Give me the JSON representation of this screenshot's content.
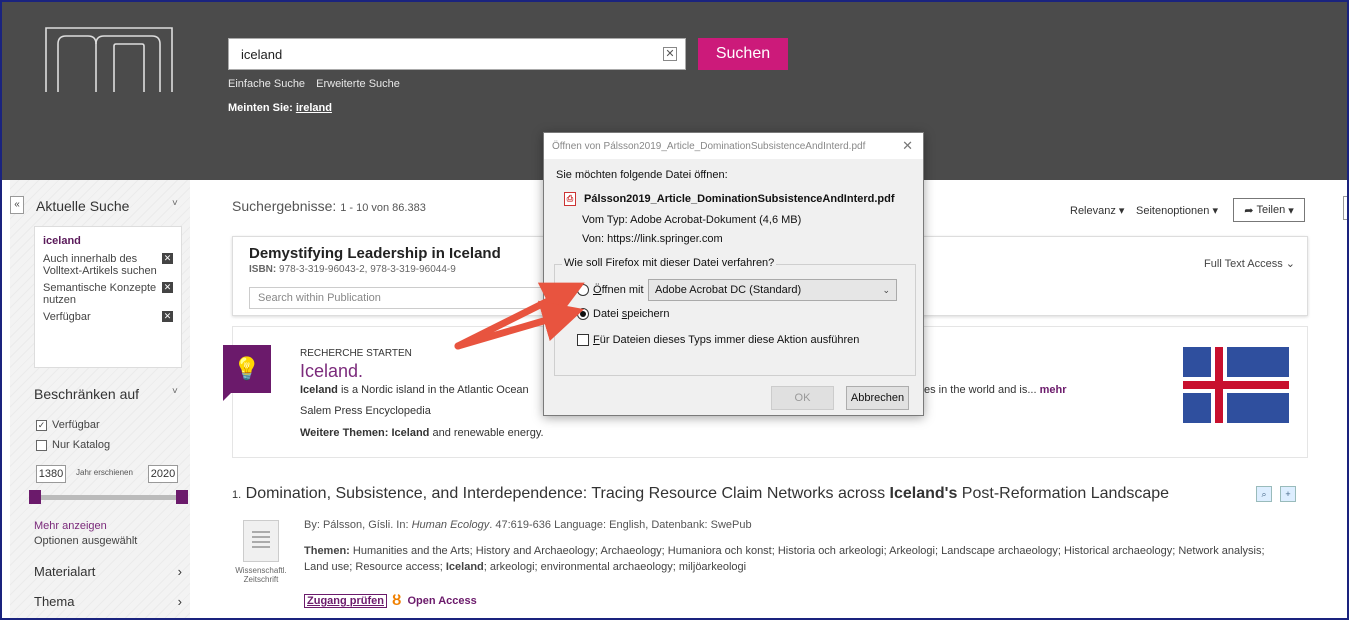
{
  "header": {
    "search_value": "iceland",
    "search_button": "Suchen",
    "links": [
      "Einfache Suche",
      "Erweiterte Suche"
    ],
    "did_you_mean_label": "Meinten Sie:",
    "did_you_mean_term": "ireland"
  },
  "sidebar": {
    "current_search_title": "Aktuelle Suche",
    "current_term": "iceland",
    "current_items": [
      "Auch innerhalb des Volltext-Artikels suchen",
      "Semantische Konzepte nutzen",
      "Verfügbar"
    ],
    "limit_title": "Beschränken auf",
    "limit_items": [
      "Verfügbar",
      "Nur Katalog"
    ],
    "year_from": "1380",
    "year_label": "Jahr erschienen",
    "year_to": "2020",
    "more_link": "Mehr anzeigen",
    "options_selected": "Optionen ausgewählt",
    "facets": [
      "Materialart",
      "Thema"
    ]
  },
  "results": {
    "count_label": "Suchergebnisse:",
    "count_value": "1 - 10 von 86.383",
    "relevance": "Relevanz",
    "page_options": "Seitenoptionen",
    "share": "Teilen"
  },
  "publication": {
    "title": "Demystifying Leadership in Iceland",
    "isbn_label": "ISBN:",
    "isbn": "978-3-319-96043-2, 978-3-319-96044-9",
    "search_placeholder": "Search within Publication",
    "access": "Full Text Access"
  },
  "research": {
    "label": "RECHERCHE STARTEN",
    "title": "Iceland.",
    "text_start_bold": "Iceland",
    "text_start": " is a Nordic island in the Atlantic Ocean",
    "text_end": "es in the world and is...",
    "more": "mehr",
    "source": "Salem Press Encyclopedia",
    "topics_label": "Weitere Themen:",
    "topics_bold": "Iceland",
    "topics_rest": " and renewable energy."
  },
  "result1": {
    "num": "1.",
    "title_before": "Domination, Subsistence, and Interdependence: Tracing Resource Claim Networks across ",
    "title_bold": "Iceland's",
    "title_after": " Post-Reformation Landscape",
    "meta_prefix": "By: Pálsson, Gísli. In: ",
    "meta_journal": "Human Ecology",
    "meta_suffix": ". 47:619-636 Language: English, Datenbank: SwePub",
    "topics_label": "Themen:",
    "topics_line1": " Humanities and the Arts; History and Archaeology; Archaeology; Humaniora och konst; Historia och arkeologi; Arkeologi; Landscape archaeology; Historical archaeology; Network analysis;",
    "topics_line2_pre": "Land use; Resource access; ",
    "topics_line2_bold": "Iceland",
    "topics_line2_post": "; arkeologi; environmental archaeology; miljöarkeologi",
    "doc_type": "Wissenschaftl. Zeitschrift",
    "access_check": "Zugang prüfen",
    "open_access": "Open Access"
  },
  "dialog": {
    "title": "Öffnen von Pálsson2019_Article_DominationSubsistenceAndInterd.pdf",
    "ask": "Sie möchten folgende Datei öffnen:",
    "filename": "Pálsson2019_Article_DominationSubsistenceAndInterd.pdf",
    "type": "Vom Typ:  Adobe Acrobat-Dokument (4,6 MB)",
    "from": "Von:  https://link.springer.com",
    "group_label": "Wie soll Firefox mit dieser Datei verfahren?",
    "open_with_pre": "",
    "open_with_u": "Ö",
    "open_with_post": "ffnen mit",
    "open_with_app": "Adobe Acrobat DC  (Standard)",
    "save_pre": "Datei ",
    "save_u": "s",
    "save_post": "peichern",
    "always_u": "F",
    "always_post": "ür Dateien dieses Typs immer diese Aktion ausführen",
    "ok": "OK",
    "cancel": "Abbrechen"
  }
}
